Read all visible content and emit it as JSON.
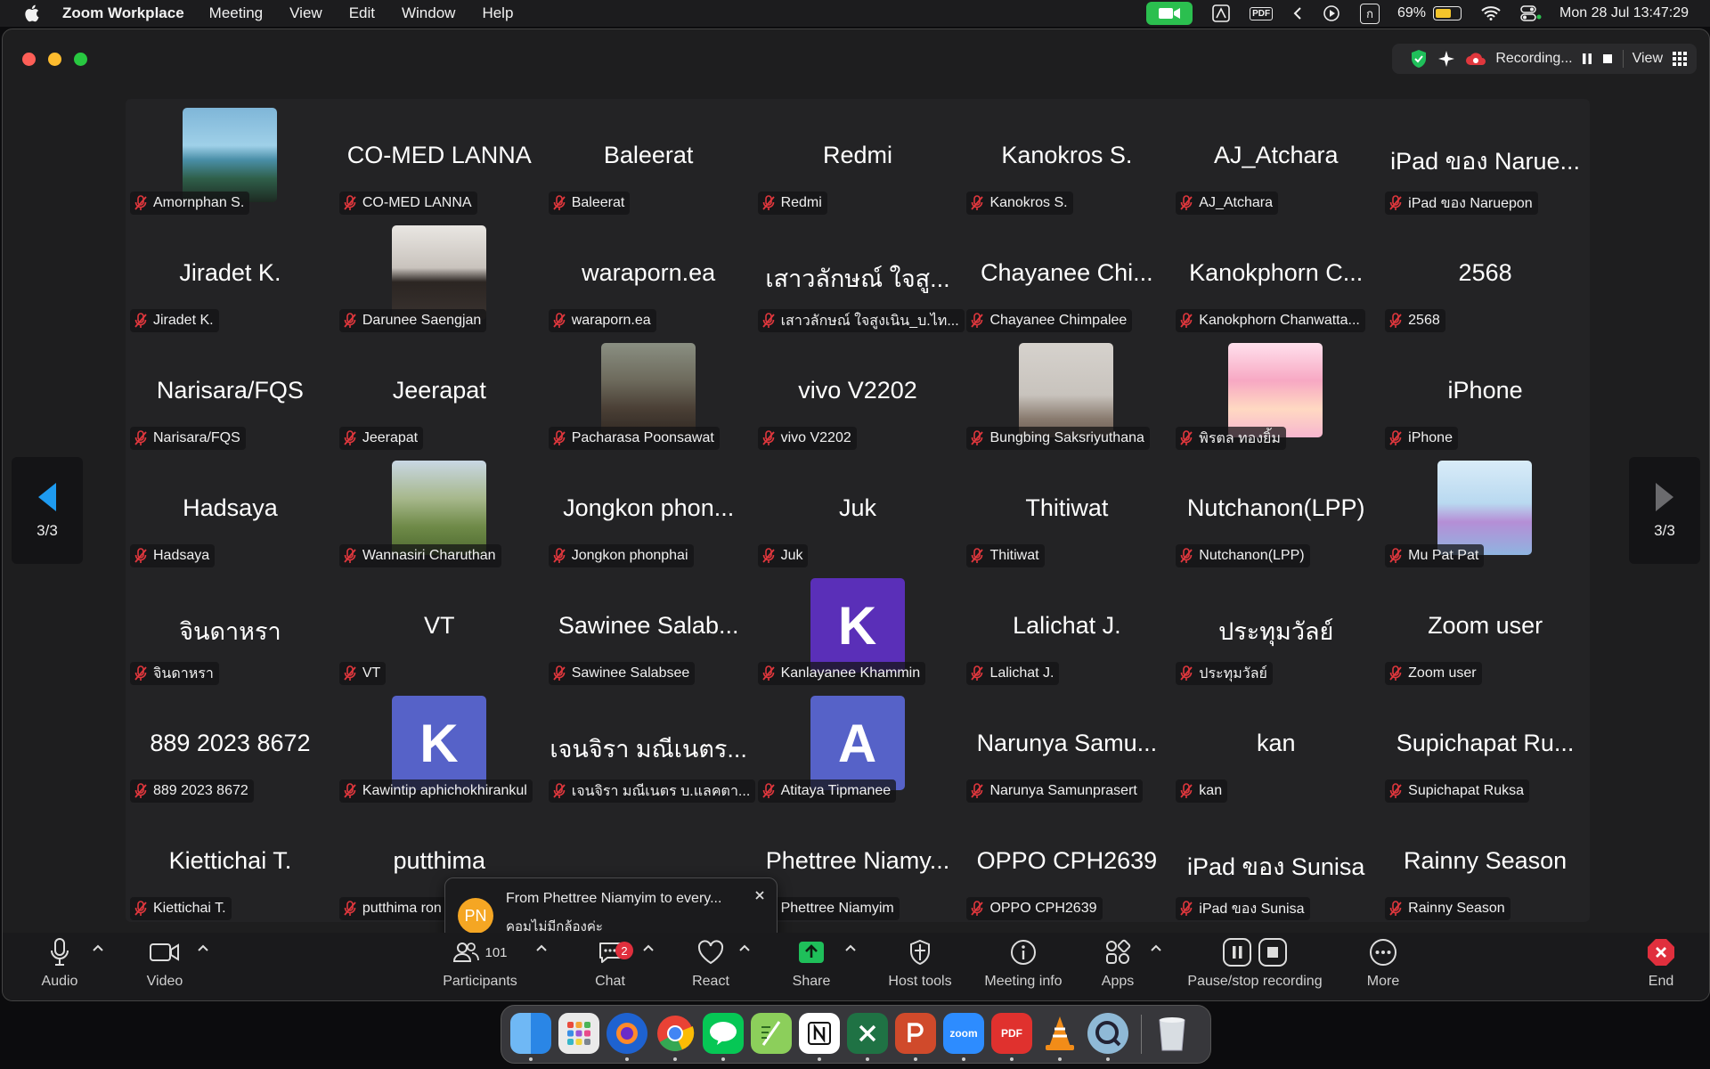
{
  "menubar": {
    "app_name": "Zoom Workplace",
    "menus": [
      "Meeting",
      "View",
      "Edit",
      "Window",
      "Help"
    ],
    "pdf_icon": "PDF",
    "n_icon": "ก",
    "battery": "69%",
    "battery_level": 0.69,
    "clock": "Mon 28 Jul  13:47:29"
  },
  "topbar": {
    "recording_label": "Recording...",
    "view_label": "View"
  },
  "page_indicator": "3/3",
  "gallery": {
    "rows": [
      [
        {
          "name": "",
          "label": "Amornphan S.",
          "photo": "beach"
        },
        {
          "name": "CO-MED LANNA",
          "label": "CO-MED LANNA"
        },
        {
          "name": "Baleerat",
          "label": "Baleerat"
        },
        {
          "name": "Redmi",
          "label": "Redmi"
        },
        {
          "name": "Kanokros S.",
          "label": "Kanokros S."
        },
        {
          "name": "AJ_Atchara",
          "label": "AJ_Atchara"
        },
        {
          "name": "iPad ของ Narue...",
          "label": "iPad ของ Naruepon"
        }
      ],
      [
        {
          "name": "Jiradet K.",
          "label": "Jiradet K."
        },
        {
          "name": "",
          "label": "Darunee Saengjan",
          "photo": "selfie"
        },
        {
          "name": "waraporn.ea",
          "label": "waraporn.ea"
        },
        {
          "name": "เสาวลักษณ์ ใจสู...",
          "label": "เสาวลักษณ์ ใจสูงเนิน_บ.ไท..."
        },
        {
          "name": "Chayanee Chi...",
          "label": "Chayanee Chimpalee"
        },
        {
          "name": "Kanokphorn C...",
          "label": "Kanokphorn Chanwatta..."
        },
        {
          "name": "2568",
          "label": "2568"
        }
      ],
      [
        {
          "name": "Narisara/FQS",
          "label": "Narisara/FQS"
        },
        {
          "name": "Jeerapat",
          "label": "Jeerapat"
        },
        {
          "name": "",
          "label": "Pacharasa  Poonsawat",
          "photo": "cafe"
        },
        {
          "name": "vivo V2202",
          "label": "vivo V2202"
        },
        {
          "name": "",
          "label": "Bungbing Saksriyuthana",
          "photo": "room"
        },
        {
          "name": "",
          "label": "พิรตล ทองยิ้ม",
          "photo": "anime"
        },
        {
          "name": "iPhone",
          "label": "iPhone"
        }
      ],
      [
        {
          "name": "Hadsaya",
          "label": "Hadsaya"
        },
        {
          "name": "",
          "label": "Wannasiri Charuthan",
          "photo": "park"
        },
        {
          "name": "Jongkon phon...",
          "label": "Jongkon phonphai"
        },
        {
          "name": "Juk",
          "label": "Juk"
        },
        {
          "name": "Thitiwat",
          "label": "Thitiwat"
        },
        {
          "name": "Nutchanon(LPP)",
          "label": "Nutchanon(LPP)"
        },
        {
          "name": "",
          "label": "Mu Pat Pat",
          "photo": "sky"
        }
      ],
      [
        {
          "name": "จินดาหรา",
          "label": "จินดาหรา"
        },
        {
          "name": "VT",
          "label": "VT"
        },
        {
          "name": "Sawinee Salab...",
          "label": "Sawinee Salabsee"
        },
        {
          "name": "",
          "label": "Kanlayanee Khammin",
          "letter": "K",
          "letter_color": "#5a2fb8"
        },
        {
          "name": "Lalichat J.",
          "label": "Lalichat J."
        },
        {
          "name": "ประทุมวัลย์",
          "label": "ประทุมวัลย์"
        },
        {
          "name": "Zoom user",
          "label": "Zoom user"
        }
      ],
      [
        {
          "name": "889 2023 8672",
          "label": "889 2023 8672"
        },
        {
          "name": "",
          "label": "Kawintip aphichokhirankul",
          "letter": "K",
          "letter_color": "#5662c8"
        },
        {
          "name": "เจนจิรา มณีเนตร...",
          "label": "เจนจิรา มณีเนตร บ.แลคตา..."
        },
        {
          "name": "",
          "label": "Atitaya Tipmanee",
          "letter": "A",
          "letter_color": "#5662c8"
        },
        {
          "name": "Narunya Samu...",
          "label": "Narunya Samunprasert"
        },
        {
          "name": "kan",
          "label": "kan"
        },
        {
          "name": "Supichapat Ru...",
          "label": "Supichapat Ruksa"
        }
      ],
      [
        {
          "name": "Kiettichai T.",
          "label": "Kiettichai T."
        },
        {
          "name": "putthima",
          "label": "putthima ron"
        },
        {
          "name": "",
          "label": ""
        },
        {
          "name": "Phettree Niamy...",
          "label": "Phettree Niamyim"
        },
        {
          "name": "OPPO CPH2639",
          "label": "OPPO CPH2639"
        },
        {
          "name": "iPad ของ Sunisa",
          "label": "iPad ของ Sunisa"
        },
        {
          "name": "Rainny Season",
          "label": "Rainny Season"
        }
      ]
    ]
  },
  "toast": {
    "initials": "PN",
    "title": "From Phettree Niamyim to every...",
    "message": "คอมไม่มีกล้องค่ะ"
  },
  "controls": {
    "audio": "Audio",
    "video": "Video",
    "participants": "Participants",
    "participants_count": "101",
    "chat": "Chat",
    "chat_badge": "2",
    "react": "React",
    "share": "Share",
    "host_tools": "Host tools",
    "meeting_info": "Meeting info",
    "apps": "Apps",
    "recording": "Pause/stop recording",
    "more": "More",
    "end": "End"
  },
  "dock": {
    "zoom": "zoom",
    "pdf": "PDF"
  },
  "colors": {
    "mute_red": "#e0373d",
    "share_green": "#1fbf5a",
    "end_red": "#e02f3d",
    "nav_arrow": "#1e9bf0"
  }
}
